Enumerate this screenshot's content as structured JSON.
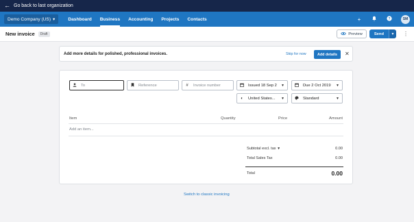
{
  "topbar": {
    "back_label": "Go back to last organization"
  },
  "nav": {
    "org_name": "Demo Company (US)",
    "links": [
      {
        "label": "Dashboard"
      },
      {
        "label": "Business"
      },
      {
        "label": "Accounting"
      },
      {
        "label": "Projects"
      },
      {
        "label": "Contacts"
      }
    ],
    "active_link": "Business",
    "avatar_initials": "SM"
  },
  "page": {
    "title": "New invoice",
    "status_badge": "Draft",
    "preview_label": "Preview",
    "send_label": "Send"
  },
  "banner": {
    "message": "Add more details for polished, professional invoices.",
    "skip_label": "Skip for now",
    "add_label": "Add details"
  },
  "form": {
    "to_placeholder": "To",
    "reference_placeholder": "Reference",
    "invoice_number_placeholder": "Invoice number",
    "issued_value": "Issued 18 Sep 2",
    "due_value": "Due 2 Oct 2019",
    "currency_value": "United States...",
    "theme_value": "Standard"
  },
  "table": {
    "headers": {
      "item": "Item",
      "quantity": "Quantity",
      "price": "Price",
      "amount": "Amount"
    },
    "add_item_placeholder": "Add an item..."
  },
  "totals": {
    "subtotal_label": "Subtotal excl. tax",
    "subtotal_value": "0.00",
    "tax_label": "Total Sales Tax",
    "tax_value": "0.00",
    "total_label": "Total",
    "total_value": "0.00"
  },
  "footer": {
    "classic_link": "Switch to classic invoicing"
  },
  "colors": {
    "nav_blue": "#1f76c2",
    "top_strip": "#16264a",
    "accent": "#1f76c2"
  }
}
